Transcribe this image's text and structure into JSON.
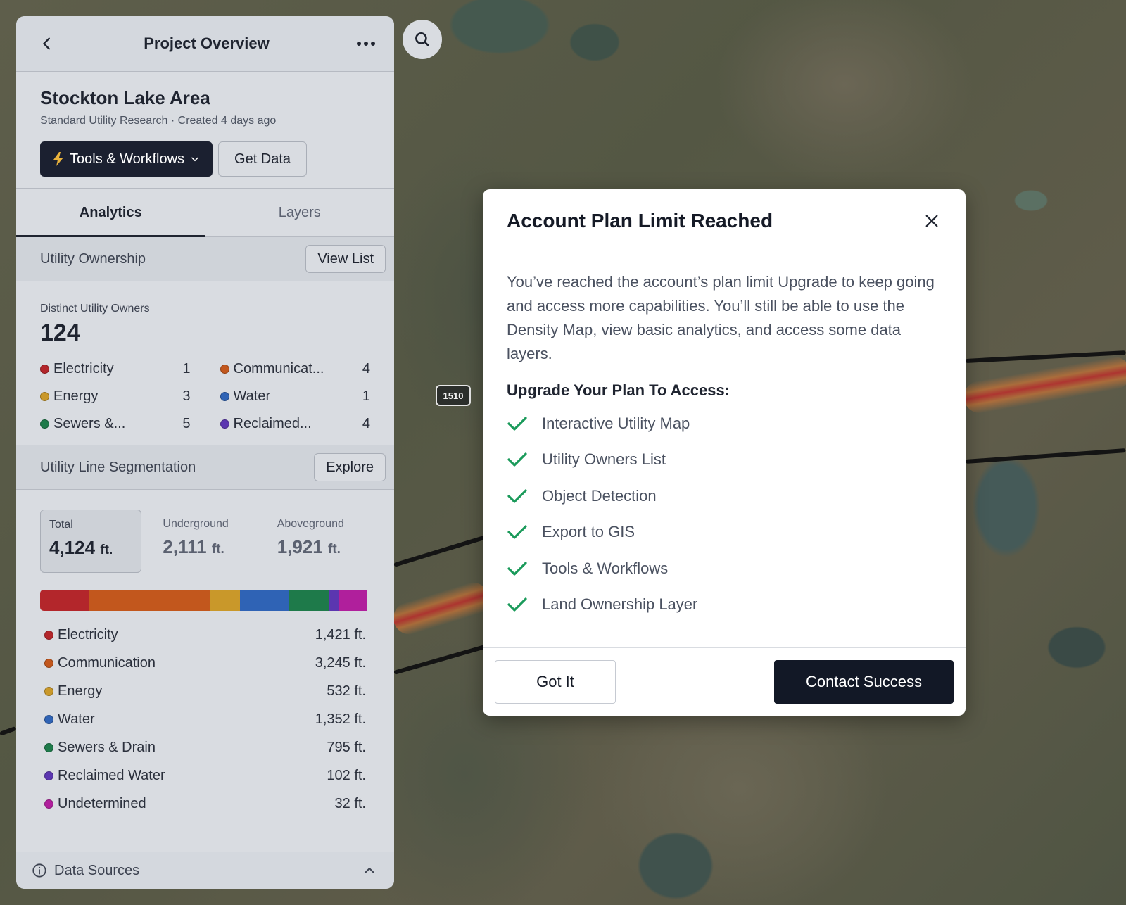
{
  "map": {
    "road_sign": "1510"
  },
  "panel": {
    "title": "Project Overview",
    "project": {
      "name": "Stockton Lake Area",
      "meta": "Standard Utility Research · Created 4 days ago"
    },
    "buttons": {
      "tools": "Tools & Workflows",
      "get_data": "Get Data"
    },
    "tabs": [
      {
        "label": "Analytics",
        "active": true
      },
      {
        "label": "Layers",
        "active": false
      }
    ],
    "ownership": {
      "title": "Utility Ownership",
      "button": "View List",
      "count_label": "Distinct Utility Owners",
      "count": "124",
      "items": [
        {
          "label": "Electricity",
          "value": "1",
          "color": "#b3262b"
        },
        {
          "label": "Communicat...",
          "value": "4",
          "color": "#c2571d"
        },
        {
          "label": "Energy",
          "value": "3",
          "color": "#c9982a"
        },
        {
          "label": "Water",
          "value": "1",
          "color": "#2f63b5"
        },
        {
          "label": "Sewers &...",
          "value": "5",
          "color": "#1e7a4a"
        },
        {
          "label": "Reclaimed...",
          "value": "4",
          "color": "#5b36b0"
        }
      ]
    },
    "segmentation": {
      "title": "Utility Line Segmentation",
      "button": "Explore",
      "stats": [
        {
          "label": "Total",
          "value": "4,124",
          "unit": "ft.",
          "active": true
        },
        {
          "label": "Underground",
          "value": "2,111",
          "unit": "ft.",
          "active": false
        },
        {
          "label": "Aboveground",
          "value": "1,921",
          "unit": "ft.",
          "active": false
        }
      ],
      "items": [
        {
          "label": "Electricity",
          "value": "1,421 ft.",
          "color": "#b3262b",
          "share": 0.15
        },
        {
          "label": "Communication",
          "value": "3,245 ft.",
          "color": "#c2571d",
          "share": 0.365
        },
        {
          "label": "Energy",
          "value": "532 ft.",
          "color": "#c9982a",
          "share": 0.09
        },
        {
          "label": "Water",
          "value": "1,352 ft.",
          "color": "#2f63b5",
          "share": 0.15
        },
        {
          "label": "Sewers & Drain",
          "value": "795 ft.",
          "color": "#1e7a4a",
          "share": 0.12
        },
        {
          "label": "Reclaimed Water",
          "value": "102 ft.",
          "color": "#5b36b0",
          "share": 0.03
        },
        {
          "label": "Undetermined",
          "value": "32 ft.",
          "color": "#b01f9c",
          "share": 0.085
        }
      ]
    },
    "footer": {
      "label": "Data Sources"
    }
  },
  "modal": {
    "title": "Account Plan Limit Reached",
    "description": "You’ve reached the account’s plan limit  Upgrade to keep going and access more capabilities. You’ll still be able to use the Density Map, view basic analytics, and access some data layers.",
    "subtitle": "Upgrade Your Plan To Access:",
    "features": [
      "Interactive Utility Map",
      "Utility Owners List",
      "Object Detection",
      "Export to GIS",
      "Tools & Workflows",
      "Land Ownership Layer"
    ],
    "secondary_button": "Got It",
    "primary_button": "Contact Success",
    "check_color": "#1a9a5a"
  }
}
